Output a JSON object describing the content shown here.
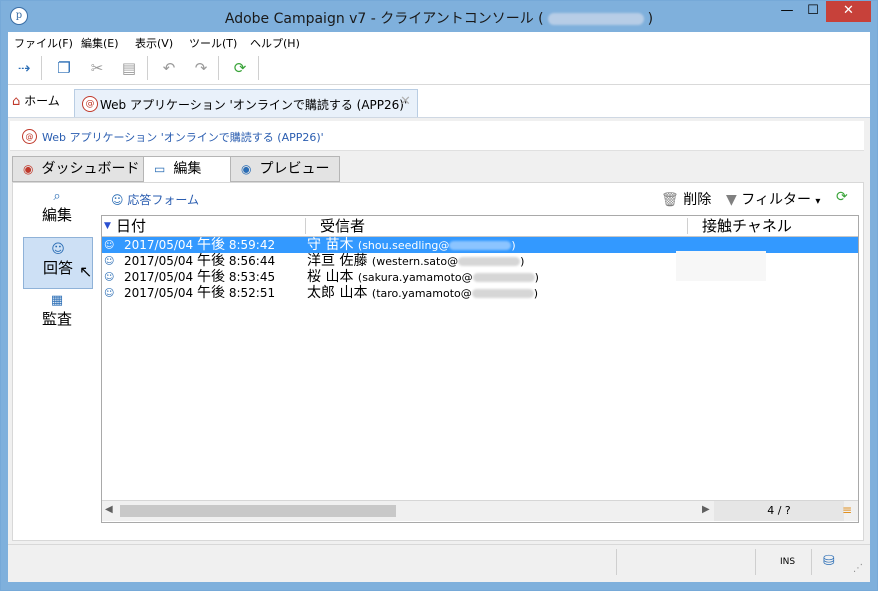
{
  "window": {
    "title": "Adobe Campaign v7 - クライアントコンソール (",
    "title_suffix": ")",
    "minimize": "—",
    "maximize": "☐",
    "close": "✕",
    "app_icon": "p"
  },
  "menu": [
    "ファイル(F)",
    "編集(E)",
    "表示(V)",
    "ツール(T)",
    "ヘルプ(H)"
  ],
  "toolbar": {
    "icons": [
      "connect-icon",
      "copy-icon",
      "cut-icon",
      "paste-icon",
      "undo-icon",
      "redo-icon",
      "refresh-icon"
    ]
  },
  "tabs": {
    "home": "ホーム",
    "document": "Web アプリケーション 'オンラインで購読する (APP26)'",
    "close": "✕"
  },
  "breadcrumb": "Web アプリケーション 'オンラインで購読する (APP26)'",
  "view_tabs": [
    {
      "label": "ダッシュボード",
      "icon": "dashboard-icon"
    },
    {
      "label": "編集",
      "icon": "edit-window-icon"
    },
    {
      "label": "プレビュー",
      "icon": "eye-icon"
    }
  ],
  "sidebar": [
    {
      "label": "編集",
      "icon": "edit-search-icon"
    },
    {
      "label": "回答",
      "icon": "responses-icon"
    },
    {
      "label": "監査",
      "icon": "audit-icon"
    }
  ],
  "panel_toolbar": {
    "title": "応答フォーム",
    "delete": "削除",
    "filter": "フィルター",
    "filter_arrow": "▾"
  },
  "grid": {
    "headers": [
      "日付",
      "受信者",
      "接触チャネル"
    ],
    "rows": [
      {
        "date": "2017/05/04",
        "ampm": "午後",
        "time": "8:59:42",
        "name": "守 苗木",
        "email": "(shou.seedling@",
        "email_end": ")"
      },
      {
        "date": "2017/05/04",
        "ampm": "午後",
        "time": "8:56:44",
        "name": "洋亘 佐藤",
        "email": "(western.sato@",
        "email_end": ")"
      },
      {
        "date": "2017/05/04",
        "ampm": "午後",
        "time": "8:53:45",
        "name": "桜 山本",
        "email": "(sakura.yamamoto@",
        "email_end": ")"
      },
      {
        "date": "2017/05/04",
        "ampm": "午後",
        "time": "8:52:51",
        "name": "太郎 山本",
        "email": "(taro.yamamoto@",
        "email_end": ")"
      }
    ],
    "page": "4 / ?"
  },
  "status": {
    "ins": "INS"
  }
}
